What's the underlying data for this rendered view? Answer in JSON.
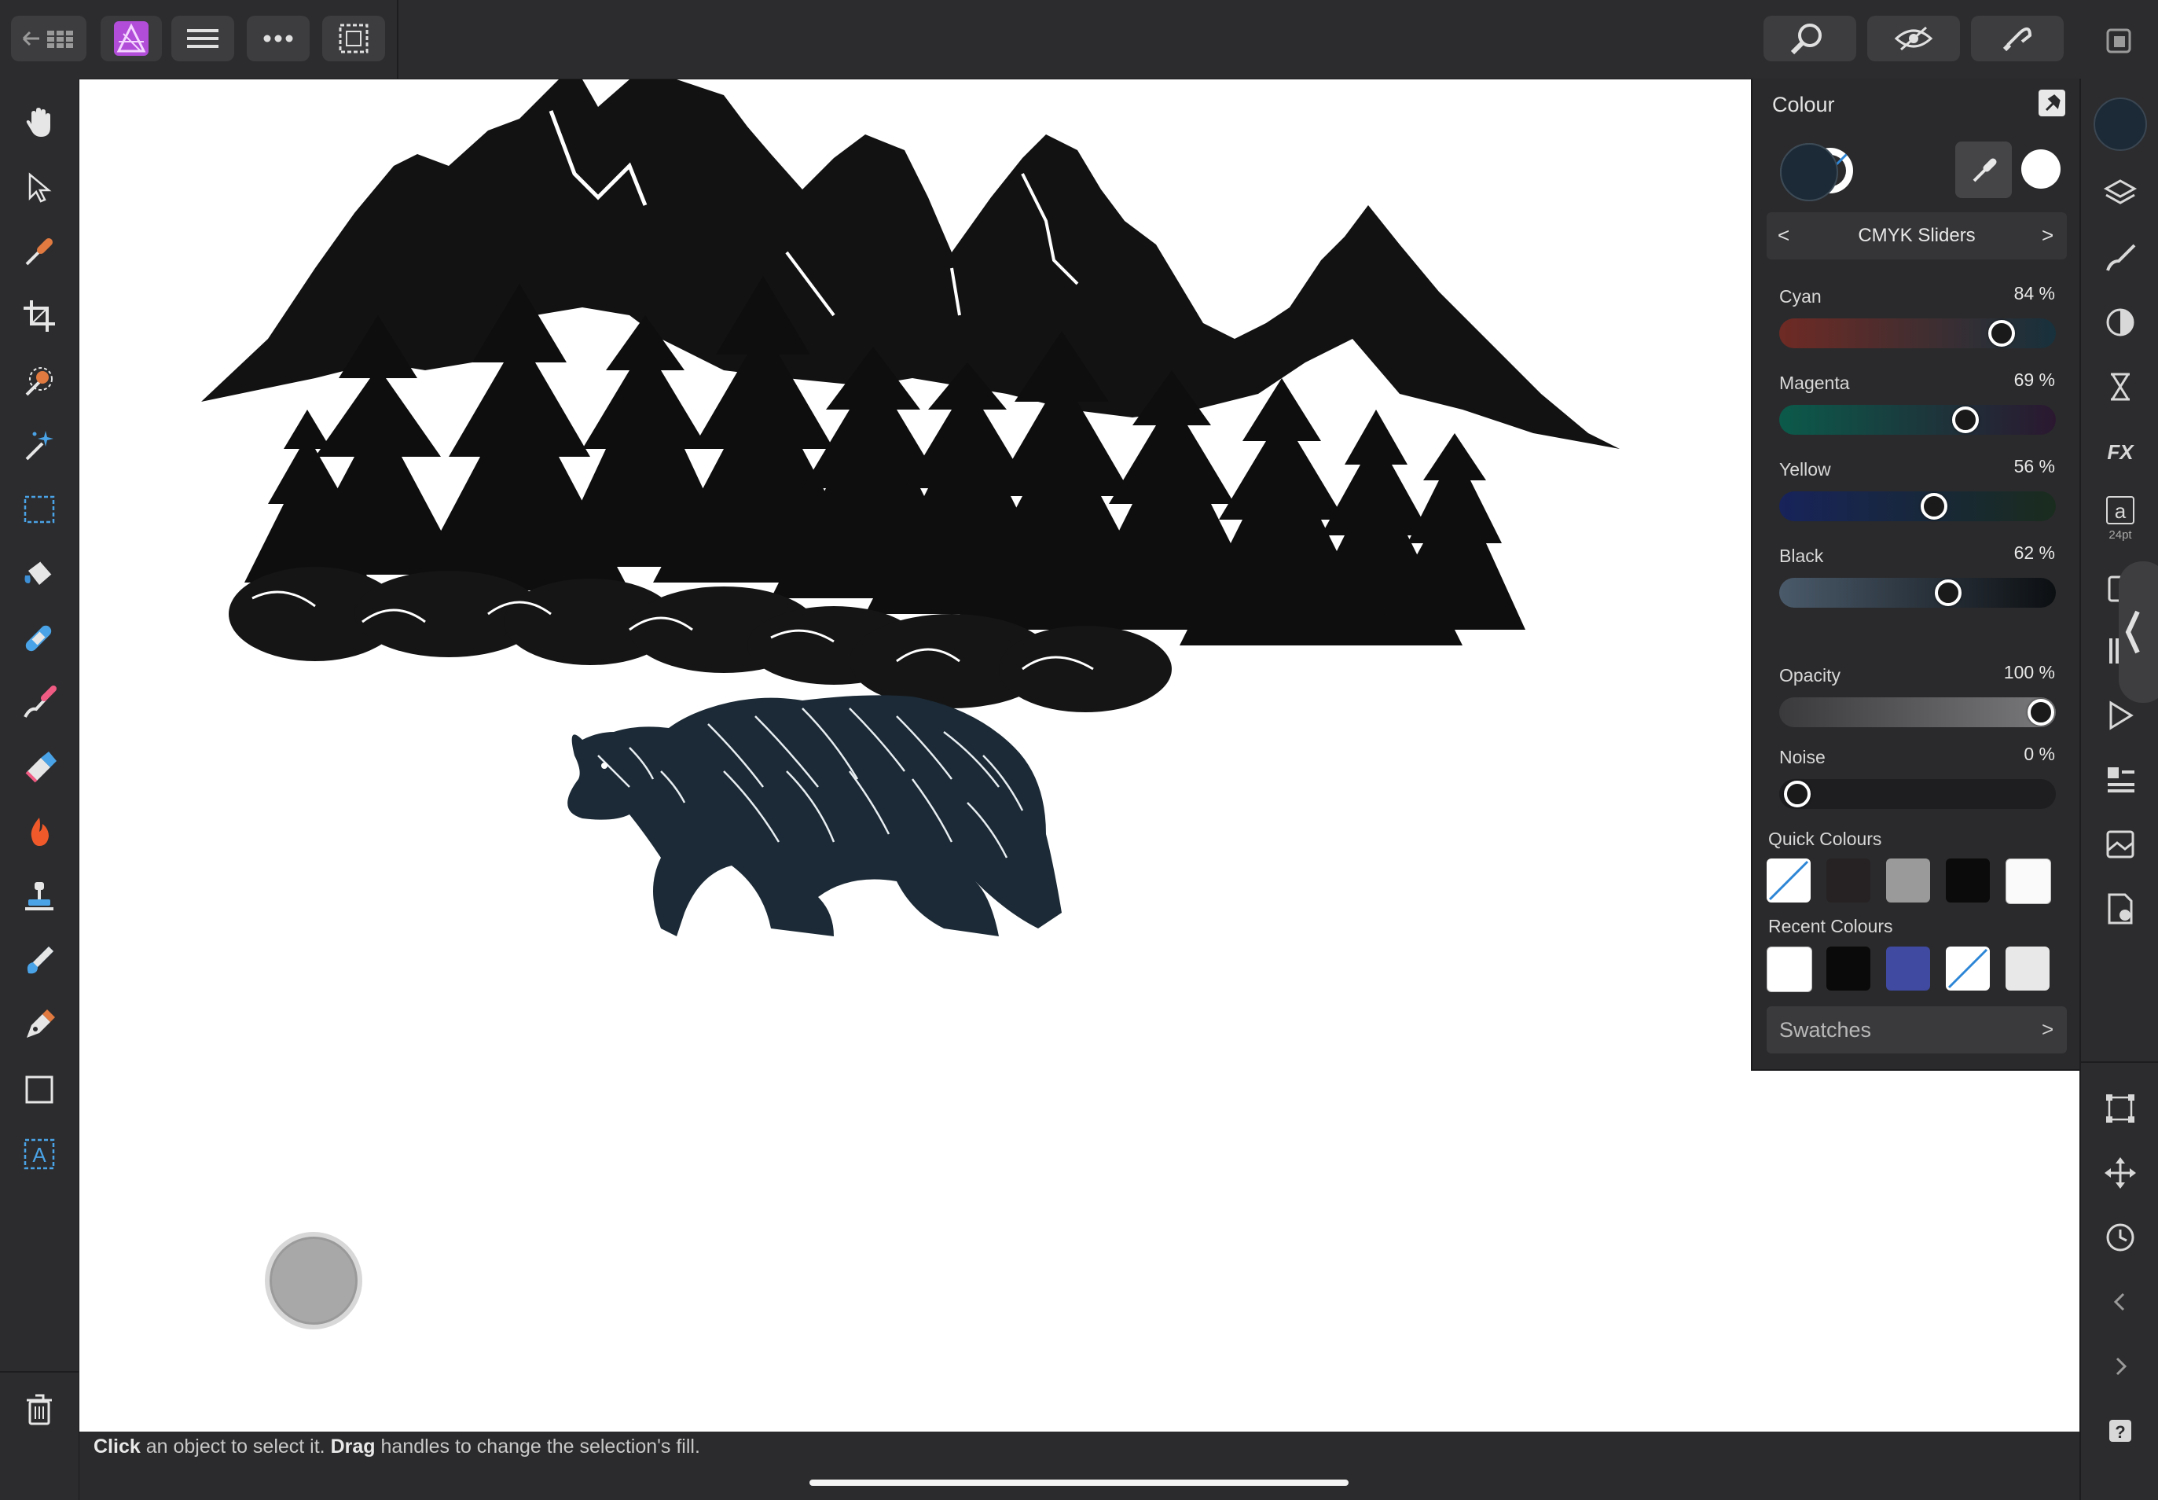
{
  "app": {
    "name": "Affinity Photo",
    "accent": "#b14dd8"
  },
  "toolbar": {
    "back_icon": "back-grid-icon",
    "persona_icon": "photo-persona-icon",
    "menu_icon": "hamburger-icon",
    "more_icon": "ellipsis-icon",
    "selection_icon": "selection-icon",
    "right_icons": [
      "view-tool-icon",
      "quickmask-icon",
      "snapping-icon",
      "window-icon"
    ]
  },
  "tools": [
    "hand-icon",
    "move-icon",
    "colour-picker-icon",
    "crop-icon",
    "brush-selection-icon",
    "magic-wand-icon",
    "marquee-icon",
    "flood-fill-icon",
    "healing-icon",
    "paint-brush-icon",
    "eraser-icon",
    "burn-icon",
    "clone-icon",
    "smudge-icon",
    "pen-icon",
    "rectangle-icon",
    "text-icon",
    "trash-icon"
  ],
  "colour_panel": {
    "title": "Colour",
    "mode": "CMYK Sliders",
    "primary_color": "#1b2a36",
    "sliders": [
      {
        "label": "Cyan",
        "value": "84 %",
        "fraction": 0.84
      },
      {
        "label": "Magenta",
        "value": "69 %",
        "fraction": 0.69
      },
      {
        "label": "Yellow",
        "value": "56 %",
        "fraction": 0.56
      },
      {
        "label": "Black",
        "value": "62 %",
        "fraction": 0.62
      }
    ],
    "opacity": {
      "label": "Opacity",
      "value": "100 %",
      "fraction": 1.0
    },
    "noise": {
      "label": "Noise",
      "value": "0 %",
      "fraction": 0.0
    },
    "quick_colours_label": "Quick Colours",
    "quick_colours": [
      "none",
      "#262223",
      "#9a9a9a",
      "#0b0b0b",
      "#fafafa"
    ],
    "recent_colours_label": "Recent Colours",
    "recent_colours": [
      "#ffffff",
      "#0a0a0a",
      "#3f4aa0",
      "none",
      "#e8e8e8"
    ],
    "swatches_label": "Swatches"
  },
  "studio": {
    "text_style_size": "24pt",
    "icons": [
      "layers-icon",
      "brushes-icon",
      "adjustments-icon",
      "navigator-icon",
      "fx-icon",
      "text-style-icon",
      "transform-icon",
      "move-handle-icon",
      "history-icon",
      "chevron-left-icon",
      "chevron-right-icon",
      "help-icon"
    ]
  },
  "status": {
    "action1": "Click",
    "text1": " an object to select it. ",
    "action2": "Drag",
    "text2": " handles to change the selection's fill."
  }
}
